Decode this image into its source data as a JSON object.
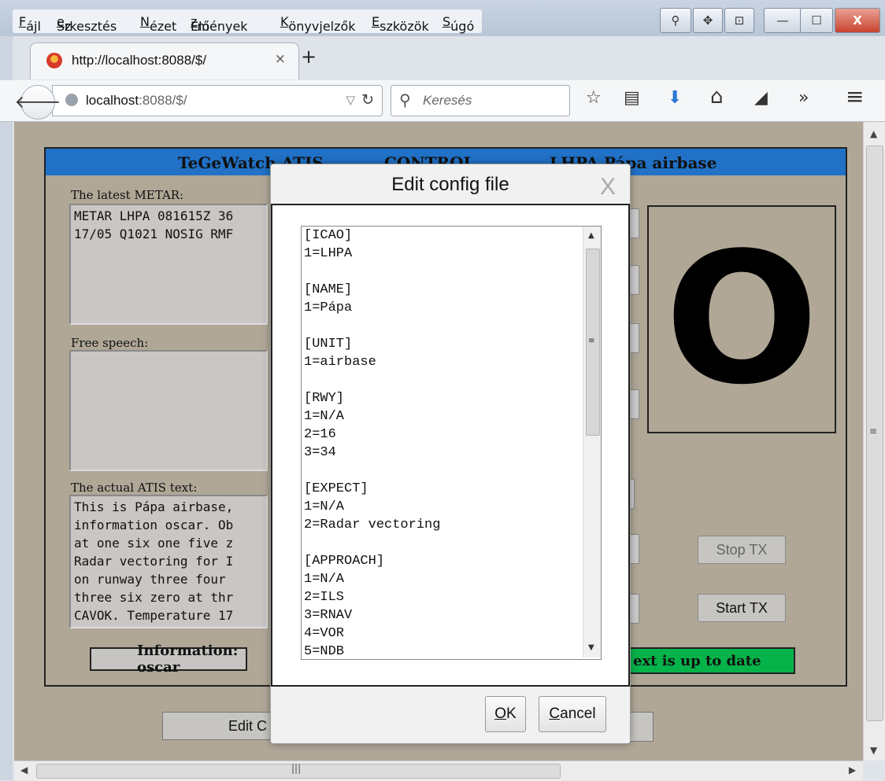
{
  "browser": {
    "menu": [
      {
        "pre": "",
        "u": "F",
        "post": "ájl"
      },
      {
        "pre": "Sz",
        "u": "e",
        "post": "rkesztés"
      },
      {
        "pre": "",
        "u": "N",
        "post": "ézet"
      },
      {
        "pre": "Elő",
        "u": "z",
        "post": "mények"
      },
      {
        "pre": "",
        "u": "K",
        "post": "önyvjelzők"
      },
      {
        "pre": "",
        "u": "E",
        "post": "szközök"
      },
      {
        "pre": "",
        "u": "S",
        "post": "úgó"
      }
    ],
    "tab_title": "http://localhost:8088/$/",
    "tab_close": "×",
    "new_tab": "+",
    "url_host": "localhost",
    "url_rest": ":8088/$/",
    "search_placeholder": "Keresés",
    "window_buttons": {
      "min": "—",
      "max": "☐",
      "close": "X"
    },
    "toolbar_icons": [
      "star-icon",
      "reading-list-icon",
      "download-icon",
      "home-icon",
      "send-icon",
      "overflow-icon",
      "menu-icon"
    ],
    "toolbar_glyphs": {
      "star": "☆",
      "list": "▤",
      "download": "⬇",
      "home": "⌂",
      "send": "◢",
      "overflow": "»",
      "menu": "≡"
    }
  },
  "app": {
    "header_title": "TeGeWatch ATIS",
    "header_control": "CONTROL",
    "header_station": "LHPA Pápa airbase",
    "metar_label": "The latest METAR:",
    "metar_text": "METAR LHPA 081615Z 36\n17/05 Q1021 NOSIG RMF",
    "speech_label": "Free speech:",
    "atis_label": "The actual ATIS text:",
    "atis_text": "This is Pápa airbase,\ninformation oscar. Ob\nat one six one five z\nRadar vectoring for I\non runway three four\nthree six zero at thr\nCAVOK. Temperature 17",
    "info_letter": "O",
    "stop_tx": "Stop TX",
    "start_tx": "Start TX",
    "info_bar": "Information: oscar",
    "status_bar": "ext is up to date",
    "edit_button": "Edit C",
    "colors": {
      "header": "#2171c6",
      "status_ok": "#06b34a",
      "page_bg": "#b0a797"
    }
  },
  "dialog": {
    "title": "Edit config file",
    "close": "X",
    "lines": [
      "[ICAO]",
      "1=LHPA",
      "",
      "[NAME]",
      "1=Pápa",
      "",
      "[UNIT]",
      "1=airbase",
      "",
      "[RWY]",
      "1=N/A",
      "2=16",
      "3=34",
      "",
      "[EXPECT]",
      "1=N/A",
      "2=Radar vectoring",
      "",
      "[APPROACH]",
      "1=N/A",
      "2=ILS",
      "3=RNAV",
      "4=VOR",
      "5=NDB"
    ],
    "ok": {
      "u": "O",
      "post": "K"
    },
    "cancel": {
      "u": "C",
      "post": "ancel"
    }
  }
}
